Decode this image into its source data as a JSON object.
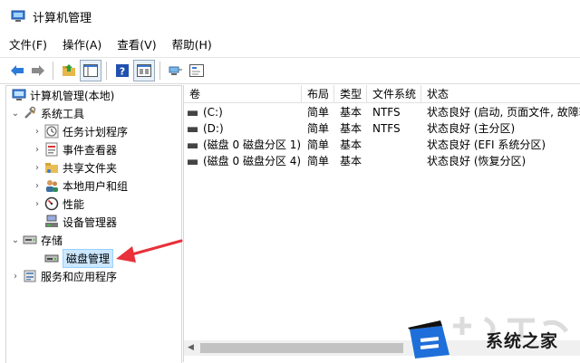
{
  "window": {
    "title": "计算机管理",
    "icon": "computer-management-icon"
  },
  "menu": [
    "文件(F)",
    "操作(A)",
    "查看(V)",
    "帮助(H)"
  ],
  "toolbar": [
    "back-arrow-icon",
    "forward-arrow-icon",
    "up-folder-icon",
    "show-hide-tree-icon",
    "help-icon",
    "properties-icon",
    "connect-icon",
    "console-icon"
  ],
  "tree": [
    {
      "label": "计算机管理(本地)",
      "icon": "computer-management-icon",
      "level": 0,
      "expander": ""
    },
    {
      "label": "系统工具",
      "icon": "tools-icon",
      "level": 1,
      "expander": "down"
    },
    {
      "label": "任务计划程序",
      "icon": "clock-icon",
      "level": 2,
      "expander": "right"
    },
    {
      "label": "事件查看器",
      "icon": "event-viewer-icon",
      "level": 2,
      "expander": "right"
    },
    {
      "label": "共享文件夹",
      "icon": "shared-folder-icon",
      "level": 2,
      "expander": "right"
    },
    {
      "label": "本地用户和组",
      "icon": "users-icon",
      "level": 2,
      "expander": "right"
    },
    {
      "label": "性能",
      "icon": "performance-icon",
      "level": 2,
      "expander": "right"
    },
    {
      "label": "设备管理器",
      "icon": "device-manager-icon",
      "level": 2,
      "expander": ""
    },
    {
      "label": "存储",
      "icon": "storage-icon",
      "level": 1,
      "expander": "down"
    },
    {
      "label": "磁盘管理",
      "icon": "disk-icon",
      "level": 2,
      "expander": "",
      "selected": true
    },
    {
      "label": "服务和应用程序",
      "icon": "services-icon",
      "level": 1,
      "expander": "right"
    }
  ],
  "columns": [
    "卷",
    "布局",
    "类型",
    "文件系统",
    "状态"
  ],
  "volumes": [
    {
      "name": "(C:)",
      "layout": "简单",
      "type": "基本",
      "fs": "NTFS",
      "status": "状态良好 (启动, 页面文件, 故障转"
    },
    {
      "name": "(D:)",
      "layout": "简单",
      "type": "基本",
      "fs": "NTFS",
      "status": "状态良好 (主分区)"
    },
    {
      "name": "(磁盘 0 磁盘分区 1)",
      "layout": "简单",
      "type": "基本",
      "fs": "",
      "status": "状态良好 (EFI 系统分区)"
    },
    {
      "name": "(磁盘 0 磁盘分区 4)",
      "layout": "简单",
      "type": "基本",
      "fs": "",
      "status": "状态良好 (恢复分区)"
    }
  ],
  "watermark": {
    "text": "系统之家"
  },
  "colors": {
    "annotation_arrow": "#e8313a",
    "selection": "#cce8ff",
    "watermark_blue": "#1e6fd9"
  }
}
